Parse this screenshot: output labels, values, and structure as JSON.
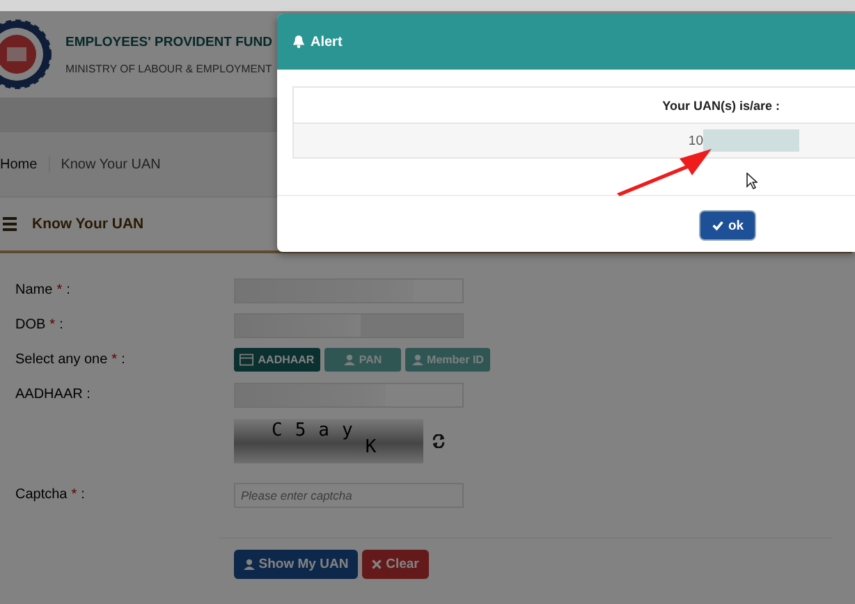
{
  "header": {
    "title": "EMPLOYEES' PROVIDENT FUND",
    "subtitle": "MINISTRY OF LABOUR & EMPLOYMENT"
  },
  "breadcrumb": [
    "Home",
    "Know Your UAN"
  ],
  "section_title": "Know Your UAN",
  "form": {
    "fields": [
      {
        "kind": "text",
        "label": "Name",
        "mark": "*",
        "separator": ":"
      },
      {
        "kind": "text",
        "label": "DOB",
        "mark": "*",
        "separator": ":"
      },
      {
        "kind": "choice",
        "label": "Select any one",
        "mark": "*",
        "separator": ":",
        "options": [
          {
            "label": "AADHAAR",
            "selected": true
          },
          {
            "label": "PAN",
            "selected": false
          },
          {
            "label": "Member ID",
            "selected": false
          }
        ]
      },
      {
        "kind": "text",
        "label": "AADHAAR :"
      },
      {
        "kind": "captcha",
        "characters": [
          "C",
          "5",
          "a",
          "y",
          "K"
        ]
      },
      {
        "kind": "input",
        "label": "Captcha",
        "mark": "*",
        "separator": ":",
        "placeholder": "Please enter captcha"
      }
    ],
    "buttons": [
      {
        "label": "Show My UAN",
        "kind": "primary"
      },
      {
        "label": "Clear",
        "kind": "danger"
      }
    ]
  },
  "alert": {
    "title": "Alert",
    "column": "Your UAN(s) is/are :",
    "uan": "10",
    "button": "ok"
  }
}
